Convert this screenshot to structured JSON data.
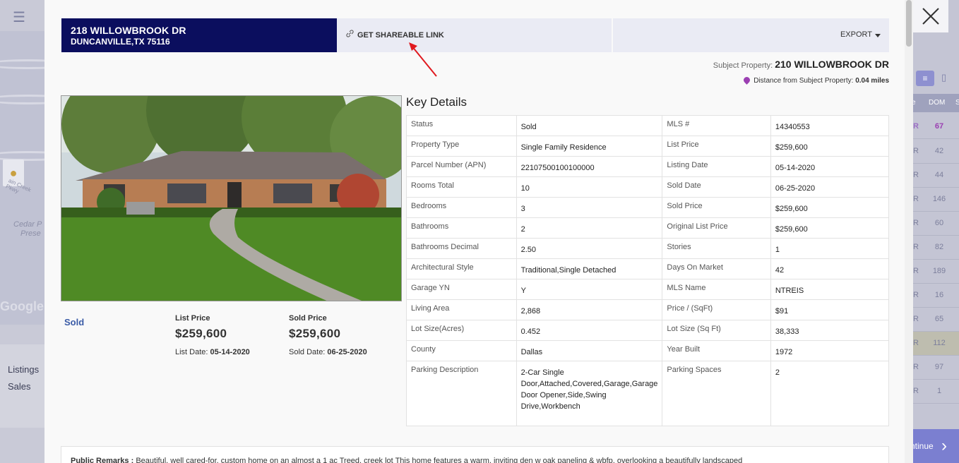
{
  "background_app": {
    "map_labels": [
      "Cedar P",
      "Prese",
      "Google",
      "ain Creek Pkwy"
    ],
    "nav": [
      "Listings",
      "Sales"
    ],
    "table": {
      "headers": [
        "e",
        "DOM",
        "S"
      ],
      "rows": [
        {
          "a": "R",
          "dom": "67"
        },
        {
          "a": "R",
          "dom": "42"
        },
        {
          "a": "R",
          "dom": "44"
        },
        {
          "a": "R",
          "dom": "146"
        },
        {
          "a": "R",
          "dom": "60"
        },
        {
          "a": "R",
          "dom": "82"
        },
        {
          "a": "R",
          "dom": "189"
        },
        {
          "a": "R",
          "dom": "16"
        },
        {
          "a": "R",
          "dom": "65"
        },
        {
          "a": "R",
          "dom": "112"
        },
        {
          "a": "R",
          "dom": "97"
        },
        {
          "a": "R",
          "dom": "1"
        }
      ]
    },
    "continue_label": "ntinue"
  },
  "header": {
    "address_line1": "218 WILLOWBROOK DR",
    "address_line2": "DUNCANVILLE,TX 75116",
    "share_label": "GET SHAREABLE LINK",
    "export_label": "EXPORT"
  },
  "subject": {
    "prefix": "Subject Property: ",
    "address": "210 WILLOWBROOK DR",
    "distance_prefix": "Distance from Subject Property: ",
    "distance_value": "0.04 miles"
  },
  "summary": {
    "status": "Sold",
    "list_price_title": "List Price",
    "list_price": "$259,600",
    "list_date_prefix": "List Date: ",
    "list_date": "05-14-2020",
    "sold_price_title": "Sold Price",
    "sold_price": "$259,600",
    "sold_date_prefix": "Sold Date: ",
    "sold_date": "06-25-2020"
  },
  "key_details": {
    "title": "Key Details",
    "rows": [
      {
        "l1": "Status",
        "v1": "Sold",
        "l2": "MLS #",
        "v2": "14340553"
      },
      {
        "l1": "Property Type",
        "v1": "Single Family Residence",
        "l2": "List Price",
        "v2": "$259,600"
      },
      {
        "l1": "Parcel Number (APN)",
        "v1": "22107500100100000",
        "l2": "Listing Date",
        "v2": "05-14-2020"
      },
      {
        "l1": "Rooms Total",
        "v1": "10",
        "l2": "Sold Date",
        "v2": "06-25-2020"
      },
      {
        "l1": "Bedrooms",
        "v1": "3",
        "l2": "Sold Price",
        "v2": "$259,600"
      },
      {
        "l1": "Bathrooms",
        "v1": "2",
        "l2": "Original List Price",
        "v2": "$259,600"
      },
      {
        "l1": "Bathrooms Decimal",
        "v1": "2.50",
        "l2": "Stories",
        "v2": "1"
      },
      {
        "l1": "Architectural Style",
        "v1": "Traditional,Single Detached",
        "l2": "Days On Market",
        "v2": "42"
      },
      {
        "l1": "Garage YN",
        "v1": "Y",
        "l2": "MLS Name",
        "v2": "NTREIS"
      },
      {
        "l1": "Living Area",
        "v1": "2,868",
        "l2": "Price / (SqFt)",
        "v2": "$91"
      },
      {
        "l1": "Lot Size(Acres)",
        "v1": "0.452",
        "l2": "Lot Size (Sq Ft)",
        "v2": "38,333"
      },
      {
        "l1": "County",
        "v1": "Dallas",
        "l2": "Year Built",
        "v2": "1972"
      },
      {
        "l1": "Parking Description",
        "v1": "2-Car Single Door,Attached,Covered,Garage,Garage Door Opener,Side,Swing Drive,Workbench",
        "l2": "Parking Spaces",
        "v2": "2"
      }
    ]
  },
  "remarks": {
    "label": "Public Remarks : ",
    "text": "Beautiful, well cared-for, custom home on an almost a 1 ac Treed, creek lot This home features a warm, inviting den w oak paneling & wbfp, overlooking a beautifully landscaped"
  },
  "colors": {
    "address_bg": "#0b0e5e",
    "sold_text": "#3a5ba6",
    "arrow": "#e0191f",
    "pin": "#9b3fb2"
  }
}
